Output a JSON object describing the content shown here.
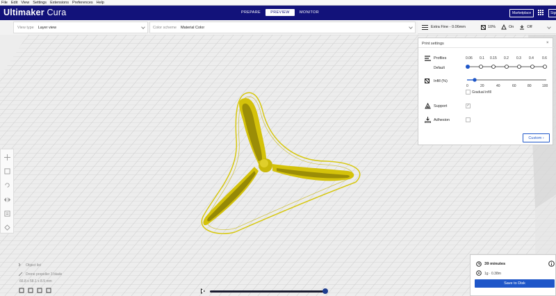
{
  "menu": [
    "File",
    "Edit",
    "View",
    "Settings",
    "Extensions",
    "Preferences",
    "Help"
  ],
  "app": {
    "name_bold": "Ultimaker",
    "name_light": " Cura"
  },
  "stages": [
    {
      "label": "PREPARE",
      "active": false
    },
    {
      "label": "PREVIEW",
      "active": true
    },
    {
      "label": "MONITOR",
      "active": false
    }
  ],
  "header": {
    "marketplace": "Marketplace",
    "signin": "Sign in"
  },
  "view_type": {
    "label": "View type",
    "value": "Layer view"
  },
  "color_scheme": {
    "label": "Color scheme",
    "value": "Material Color"
  },
  "print_bar": {
    "profile": "Extra Fine - 0.06mm",
    "infill": "10%",
    "support": "On",
    "adhesion": "Off"
  },
  "print_settings": {
    "title": "Print settings",
    "profiles_label": "Profiles",
    "profile_values": [
      "0.06",
      "0.1",
      "0.15",
      "0.2",
      "0.3",
      "0.4",
      "0.6"
    ],
    "profile_selected_index": 0,
    "default_label": "Default",
    "infill_label": "Infill (%)",
    "infill_ticks": [
      "0",
      "20",
      "40",
      "60",
      "80",
      "100"
    ],
    "infill_value": 10,
    "gradual_infill": "Gradual infill",
    "support_label": "Support",
    "support_checked": true,
    "adhesion_label": "Adhesion",
    "adhesion_checked": false,
    "custom_button": "Custom"
  },
  "estimate": {
    "time": "39 minutes",
    "material": "1g · 0.38m",
    "save_button": "Save to Disk"
  },
  "object_panel": {
    "list_label": "Object list",
    "object_name": "Drone propeller 3 blade",
    "dimensions": "66.8 x 58.1 x 8.5 mm"
  },
  "layer_slider": {
    "progress": 1.0
  },
  "colors": {
    "header_bg": "#12127a",
    "accent": "#1e56c8",
    "model": "#d4c20a",
    "model_dark": "#6b6205"
  }
}
